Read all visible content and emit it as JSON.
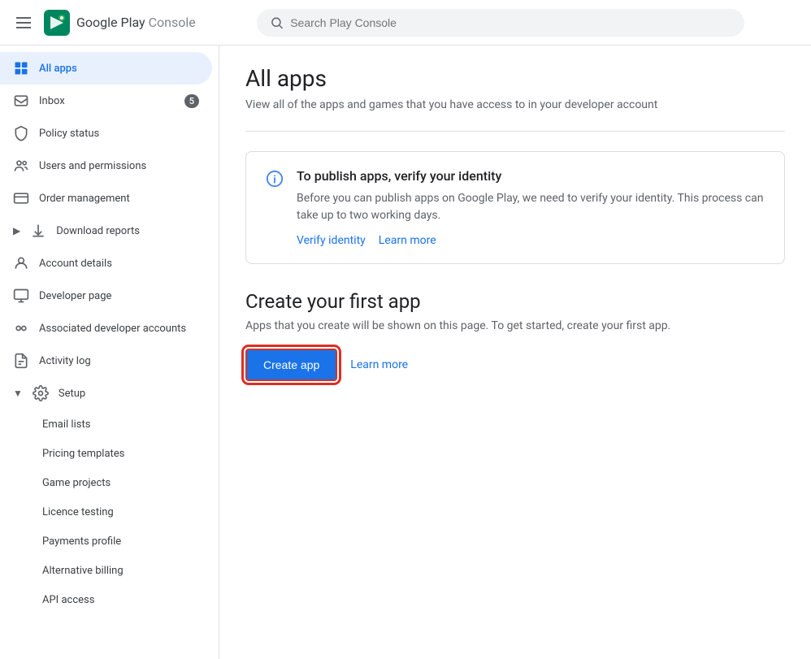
{
  "topbar": {
    "logo_text_play": "Google Play",
    "logo_text_console": "Console",
    "search_placeholder": "Search Play Console"
  },
  "sidebar": {
    "items": [
      {
        "id": "all-apps",
        "label": "All apps",
        "icon": "grid",
        "active": true,
        "badge": null,
        "arrow": null
      },
      {
        "id": "inbox",
        "label": "Inbox",
        "icon": "inbox",
        "active": false,
        "badge": "5",
        "arrow": null
      },
      {
        "id": "policy-status",
        "label": "Policy status",
        "icon": "shield",
        "active": false,
        "badge": null,
        "arrow": null
      },
      {
        "id": "users-permissions",
        "label": "Users and permissions",
        "icon": "people",
        "active": false,
        "badge": null,
        "arrow": null
      },
      {
        "id": "order-management",
        "label": "Order management",
        "icon": "credit-card",
        "active": false,
        "badge": null,
        "arrow": null
      },
      {
        "id": "download-reports",
        "label": "Download reports",
        "icon": "download",
        "active": false,
        "badge": null,
        "arrow": "right"
      },
      {
        "id": "account-details",
        "label": "Account details",
        "icon": "person",
        "active": false,
        "badge": null,
        "arrow": null
      },
      {
        "id": "developer-page",
        "label": "Developer page",
        "icon": "monitor",
        "active": false,
        "badge": null,
        "arrow": null
      },
      {
        "id": "associated-developer",
        "label": "Associated developer accounts",
        "icon": "link",
        "active": false,
        "badge": null,
        "arrow": null
      },
      {
        "id": "activity-log",
        "label": "Activity log",
        "icon": "file",
        "active": false,
        "badge": null,
        "arrow": null
      },
      {
        "id": "setup",
        "label": "Setup",
        "icon": "gear",
        "active": false,
        "badge": null,
        "arrow": "down"
      }
    ],
    "sub_items": [
      {
        "id": "email-lists",
        "label": "Email lists"
      },
      {
        "id": "pricing-templates",
        "label": "Pricing templates"
      },
      {
        "id": "game-projects",
        "label": "Game projects"
      },
      {
        "id": "licence-testing",
        "label": "Licence testing"
      },
      {
        "id": "payments-profile",
        "label": "Payments profile"
      },
      {
        "id": "alternative-billing",
        "label": "Alternative billing"
      },
      {
        "id": "api-access",
        "label": "API access"
      }
    ]
  },
  "content": {
    "page_title": "All apps",
    "page_subtitle": "View all of the apps and games that you have access to in your developer account",
    "info_card": {
      "title": "To publish apps, verify your identity",
      "text": "Before you can publish apps on Google Play, we need to verify your identity. This process can take up to two working days.",
      "verify_label": "Verify identity",
      "learn_more_label": "Learn more"
    },
    "create_section": {
      "title": "Create your first app",
      "text": "Apps that you create will be shown on this page. To get started, create your first app.",
      "create_btn_label": "Create app",
      "learn_more_label": "Learn more"
    }
  }
}
